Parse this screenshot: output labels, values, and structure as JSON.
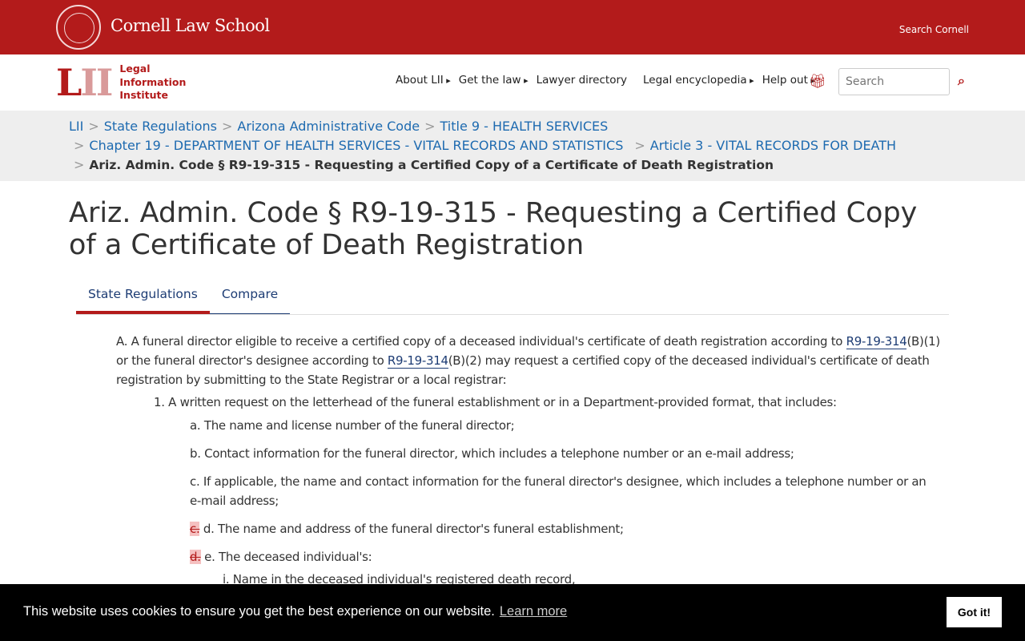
{
  "header": {
    "school": "Cornell Law School",
    "search_cornell": "Search Cornell"
  },
  "lii": {
    "mark": "LII",
    "line1": "Legal",
    "line2": "Information",
    "line3": "Institute"
  },
  "nav": {
    "items": [
      "About LII",
      "Get the law",
      "Lawyer directory",
      "Legal encyclopedia",
      "Help out"
    ],
    "search_placeholder": "Search"
  },
  "breadcrumb": [
    "LII",
    "State Regulations",
    "Arizona Administrative Code",
    "Title 9 - HEALTH SERVICES",
    "Chapter 19 - DEPARTMENT OF HEALTH SERVICES - VITAL RECORDS AND STATISTICS",
    "Article 3 - VITAL RECORDS FOR DEATH",
    "Ariz. Admin. Code § R9-19-315 - Requesting a Certified Copy of a Certificate of Death Registration"
  ],
  "title": "Ariz. Admin. Code § R9-19-315 - Requesting a Certified Copy of a Certificate of Death Registration",
  "tabs": [
    "State Regulations",
    "Compare"
  ],
  "content": {
    "a1": "A. A funeral director eligible to receive a certified copy of a deceased individual's certificate of death registration according to ",
    "link1": "R9-19-314",
    "a2": "(B)(1) or the funeral director's designee according to ",
    "link2": "R9-19-314",
    "a3": "(B)(2) may request a certified copy of the deceased individual's certificate of death registration by submitting to the State Registrar or a local registrar:",
    "p1": "1. A written request on the letterhead of the funeral establishment or in a Department-provided format, that includes:",
    "pa": "a. The name and license number of the funeral director;",
    "pb": "b. Contact information for the funeral director, which includes a telephone number or an e-mail address;",
    "pc": "c. If applicable, the name and contact information for the funeral director's designee, which includes a telephone number or an e-mail address;",
    "pd_del": "c.",
    "pd": " d. The name and address of the funeral director's funeral establishment;",
    "pe_del": "d.",
    "pe": " e. The deceased individual's:",
    "pi": "i. Name in the deceased individual's registered death record,"
  },
  "cookie": {
    "message": "This website uses cookies to ensure you get the best experience on our website.",
    "learn_more": "Learn more",
    "button": "Got it!"
  }
}
